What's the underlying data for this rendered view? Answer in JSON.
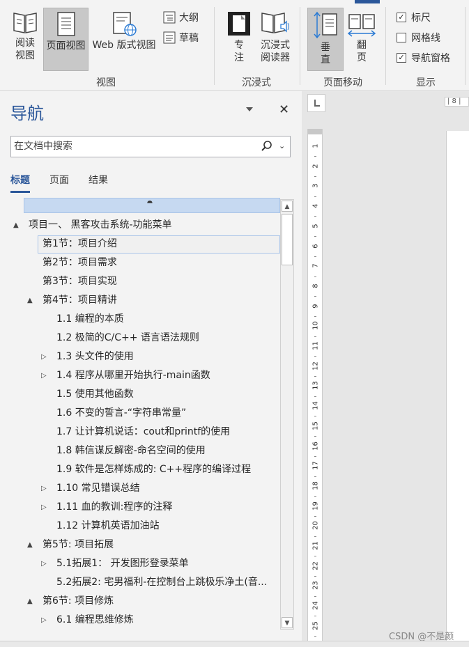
{
  "ribbon": {
    "view_group": {
      "label": "视图",
      "read_mode": "阅读\n视图",
      "print_layout": "页面视图",
      "web_layout": "Web 版式视图",
      "outline": "大纲",
      "draft": "草稿"
    },
    "immersive_group": {
      "label": "沉浸式",
      "focus": "专\n注",
      "immersive_reader": "沉浸式\n阅读器"
    },
    "page_movement_group": {
      "label": "页面移动",
      "vertical": "垂\n直",
      "side_to_side": "翻\n页"
    },
    "show_group": {
      "label": "显示",
      "ruler": {
        "label": "标尺",
        "checked": true
      },
      "gridlines": {
        "label": "网格线",
        "checked": false
      },
      "navigation_pane": {
        "label": "导航窗格",
        "checked": true
      }
    }
  },
  "nav": {
    "title": "导航",
    "search_placeholder": "在文档中搜索",
    "tabs": [
      {
        "label": "标题",
        "active": true
      },
      {
        "label": "页面",
        "active": false
      },
      {
        "label": "结果",
        "active": false
      }
    ],
    "items": [
      {
        "level": 0,
        "arrow": "▲",
        "label": "项目一、 黑客攻击系统-功能菜单"
      },
      {
        "level": 1,
        "arrow": "",
        "label": "第1节：项目介绍",
        "selected": true
      },
      {
        "level": 1,
        "arrow": "",
        "label": "第2节：项目需求"
      },
      {
        "level": 1,
        "arrow": "",
        "label": "第3节：项目实现"
      },
      {
        "level": 1,
        "arrow": "▲",
        "label": "第4节：项目精讲"
      },
      {
        "level": 2,
        "arrow": "",
        "label": "1.1 编程的本质"
      },
      {
        "level": 2,
        "arrow": "",
        "label": "1.2 极简的C/C++ 语言语法规则"
      },
      {
        "level": 2,
        "arrow": "▷",
        "label": "1.3 头文件的使用"
      },
      {
        "level": 2,
        "arrow": "▷",
        "label": "1.4 程序从哪里开始执行-main函数"
      },
      {
        "level": 2,
        "arrow": "",
        "label": "1.5 使用其他函数"
      },
      {
        "level": 2,
        "arrow": "",
        "label": "1.6 不变的誓言-“字符串常量”"
      },
      {
        "level": 2,
        "arrow": "",
        "label": "1.7 让计算机说话：cout和printf的使用"
      },
      {
        "level": 2,
        "arrow": "",
        "label": "1.8 韩信谋反解密-命名空间的使用"
      },
      {
        "level": 2,
        "arrow": "",
        "label": "1.9 软件是怎样炼成的: C++程序的编译过程"
      },
      {
        "level": 2,
        "arrow": "▷",
        "label": "1.10 常见错误总结"
      },
      {
        "level": 2,
        "arrow": "▷",
        "label": "1.11 血的教训:程序的注释"
      },
      {
        "level": 2,
        "arrow": "",
        "label": "1.12 计算机英语加油站"
      },
      {
        "level": 1,
        "arrow": "▲",
        "label": "第5节: 项目拓展"
      },
      {
        "level": 2,
        "arrow": "▷",
        "label": "5.1拓展1：  开发图形登录菜单"
      },
      {
        "level": 2,
        "arrow": "",
        "label": "5.2拓展2: 宅男福利-在控制台上跳极乐净土(音..."
      },
      {
        "level": 1,
        "arrow": "▲",
        "label": "第6节: 项目修炼"
      },
      {
        "level": 2,
        "arrow": "▷",
        "label": "6.1 编程思维修炼"
      }
    ]
  },
  "ruler": {
    "horizontal_label": "| 8 |",
    "vertical_numbers": [
      "1",
      "2",
      "3",
      "4",
      "5",
      "6",
      "7",
      "8",
      "9",
      "10",
      "11",
      "12",
      "13",
      "14",
      "15",
      "16",
      "17",
      "18",
      "19",
      "20",
      "21",
      "22",
      "23",
      "24",
      "25"
    ]
  },
  "watermark": "CSDN @不是颜",
  "colors": {
    "accent": "#2b579a",
    "selection": "#c6d9f1"
  }
}
